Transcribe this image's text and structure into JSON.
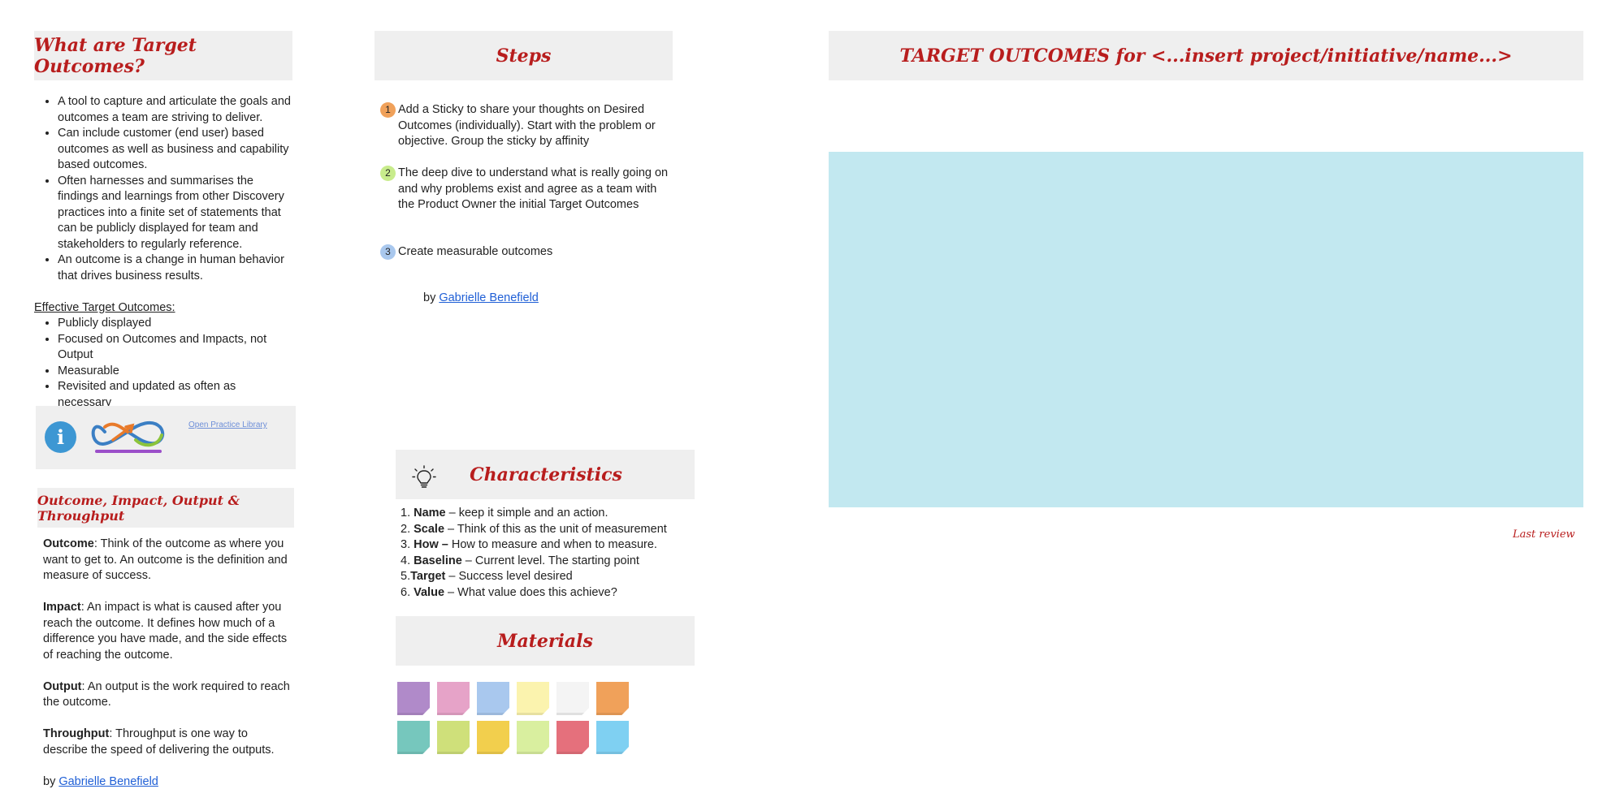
{
  "what_panel": {
    "title": "What are Target Outcomes?",
    "bullets": [
      "A tool to capture and articulate the goals and outcomes a team are striving to deliver.",
      "Can include customer (end user) based outcomes as well as business and capability based outcomes.",
      "Often harnesses and summarises the findings and learnings from other Discovery practices into a finite set of statements that can be publicly displayed for team and stakeholders to regularly reference.",
      "An outcome is a change in human behavior that drives business results."
    ],
    "effective_heading": "Effective Target Outcomes:",
    "effective_bullets": [
      "Publicly displayed",
      "Focused on Outcomes and Impacts, not Output",
      "Measurable",
      "Revisited and updated as often as necessary"
    ],
    "info_link": "Open Practice Library"
  },
  "oiot_panel": {
    "title": "Outcome, Impact, Output & Throughput",
    "items": [
      {
        "term": "Outcome",
        "text": ": Think of the outcome as where you want to get to. An outcome is the definition and measure of success."
      },
      {
        "term": "Impact",
        "text": ": An impact is what is caused after you reach the outcome. It defines how much of a difference you have made, and the side effects of reaching the outcome."
      },
      {
        "term": "Output",
        "text": ": An output is the work required to reach the outcome."
      },
      {
        "term": "Throughput",
        "text": ": Throughput is one way to describe the speed of delivering the outputs."
      }
    ],
    "by_prefix": "by ",
    "author": "Gabrielle Benefield"
  },
  "steps_panel": {
    "title": "Steps",
    "steps": [
      {
        "num": "1",
        "text": "Add a Sticky to share your thoughts on Desired Outcomes (individually). Start with the problem or objective. Group the sticky by affinity",
        "color": "#f0a15a"
      },
      {
        "num": "2",
        "text": "The deep dive to understand what is really going on and why problems exist and agree as a team with the Product Owner the initial Target Outcomes",
        "color": "#c8ec8c"
      },
      {
        "num": "3",
        "text": "Create measurable outcomes",
        "color": "#a9c8ee"
      }
    ],
    "by_prefix": "by ",
    "author": "Gabrielle Benefield"
  },
  "characteristics_panel": {
    "title": "Characteristics",
    "items": [
      {
        "prefix": "1. ",
        "term": "Name",
        "text": " – keep it simple and an action."
      },
      {
        "prefix": "2. ",
        "term": "Scale",
        "text": " – Think of this as the unit of measurement"
      },
      {
        "prefix": "3. ",
        "term": "How –",
        "text": " How to measure and when to measure."
      },
      {
        "prefix": "4. ",
        "term": "Baseline",
        "text": " – Current level. The starting point"
      },
      {
        "prefix": "5.",
        "term": "Target",
        "text": " – Success level desired"
      },
      {
        "prefix": "6. ",
        "term": "Value",
        "text": " – What value does this achieve?"
      }
    ]
  },
  "materials_panel": {
    "title": "Materials",
    "sticky_colors": [
      [
        "#b08ac9",
        "#e6a3c8",
        "#a9c8ee",
        "#fbf3ae",
        "#f4f4f4",
        "#f0a15a"
      ],
      [
        "#76c7bd",
        "#cfe07a",
        "#f2cf4d",
        "#d9ef9f",
        "#e5707c",
        "#7fd0f2"
      ]
    ]
  },
  "board": {
    "title": "TARGET OUTCOMES for <...insert project/initiative/name...>",
    "canvas_color": "#c2e8f0",
    "last_review": "Last review"
  }
}
